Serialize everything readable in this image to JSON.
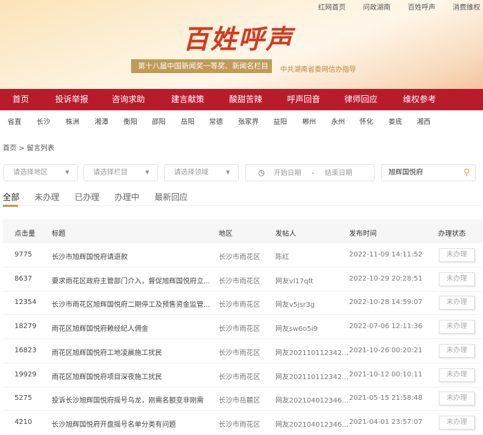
{
  "top_links": [
    "红网首页",
    "问政湖南",
    "百姓呼声",
    "消费维权"
  ],
  "logo": "百姓呼声",
  "award": "第十八届中国新闻奖一等奖、新闻名栏目",
  "guide": "中共湖南省委网信办指导",
  "nav": [
    "首页",
    "投诉举报",
    "咨询求助",
    "建言献策",
    "酸甜苦辣",
    "呼声回音",
    "律师回应",
    "维权参考"
  ],
  "regions": [
    "省直",
    "长沙",
    "株洲",
    "湘潭",
    "衡阳",
    "邵阳",
    "岳阳",
    "常德",
    "张家界",
    "益阳",
    "郴州",
    "永州",
    "怀化",
    "娄底",
    "湘西"
  ],
  "breadcrumb": {
    "home": "首页",
    "sep": ">",
    "current": "留言列表"
  },
  "filters": {
    "area": "请选择地区",
    "column": "请选择栏目",
    "field": "请选择领域",
    "start": "开始日期",
    "dash": "-",
    "end": "结束日期",
    "search": "旭辉国悦府"
  },
  "tabs": [
    "全部",
    "未办理",
    "已办理",
    "办理中",
    "最新回应"
  ],
  "columns": [
    "点击量",
    "标题",
    "地区",
    "发帖人",
    "发布时间",
    "办理状态"
  ],
  "rows": [
    {
      "clicks": "9775",
      "title": "长沙市旭辉国悦府请退款",
      "area": "长沙市雨花区",
      "poster": "陈红",
      "time": "2022-11-09 14:11:52",
      "status": "未办理"
    },
    {
      "clicks": "8637",
      "title": "要求雨花区政府主管部门介入，督促旭辉国悦府立...",
      "area": "长沙市雨花区",
      "poster": "网友vl17qft",
      "time": "2022-10-29 20:28:51",
      "status": "未办理"
    },
    {
      "clicks": "12354",
      "title": "长沙市雨花区旭辉国悦府二期停工及预售资金监管...",
      "area": "长沙市雨花区",
      "poster": "网友v5jsr3g",
      "time": "2022-10-28 14:59:07",
      "status": "未办理"
    },
    {
      "clicks": "18279",
      "title": "雨花区旭辉国悦府赖经纪人佣金",
      "area": "长沙市雨花区",
      "poster": "网友sw6o5i9",
      "time": "2022-07-06 12:11:36",
      "status": "未办理"
    },
    {
      "clicks": "16823",
      "title": "雨花区旭辉国悦府工地凌晨施工扰民",
      "area": "长沙市雨花区",
      "poster": "网友202110112342...",
      "time": "2021-10-26 00:20:21",
      "status": "未办理"
    },
    {
      "clicks": "19929",
      "title": "雨花区旭辉国悦府项目深夜施工扰民",
      "area": "长沙市雨花区",
      "poster": "网友202110112342...",
      "time": "2021-10-12 00:10:11",
      "status": "未办理"
    },
    {
      "clicks": "5275",
      "title": "投诉长沙旭辉国悦府摇号乌龙，刚需名额变非刚需",
      "area": "长沙市岳麓区",
      "poster": "网友202104012346...",
      "time": "2021-05-15 21:58:48",
      "status": "未办理"
    },
    {
      "clicks": "4210",
      "title": "长沙旭辉国悦府开盘摇号名单分类有问题",
      "area": "长沙市雨花区",
      "poster": "网友202104012346...",
      "time": "2021-04-01 23:57:07",
      "status": "未办理"
    }
  ]
}
